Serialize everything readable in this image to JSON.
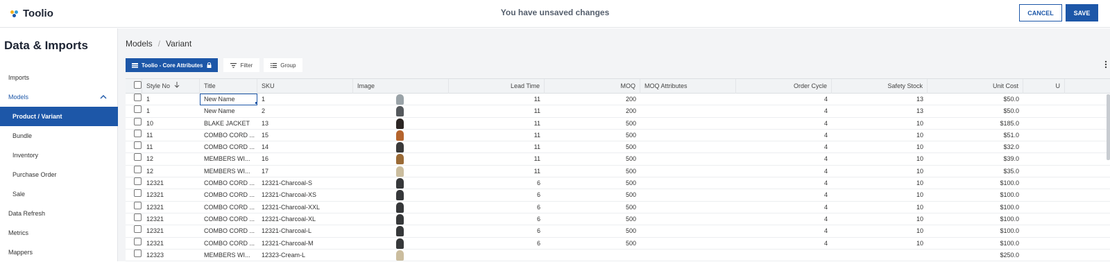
{
  "app": {
    "name": "Toolio",
    "logo_colors": [
      "#f2b01e",
      "#2f9bd7",
      "#1d57a8"
    ]
  },
  "header": {
    "status": "You have unsaved changes",
    "cancel_label": "CANCEL",
    "save_label": "SAVE"
  },
  "sidebar": {
    "title": "Data & Imports",
    "items": [
      {
        "label": "Imports"
      },
      {
        "label": "Models",
        "expanded": true
      },
      {
        "label": "Product / Variant",
        "selected": true
      },
      {
        "label": "Bundle"
      },
      {
        "label": "Inventory"
      },
      {
        "label": "Purchase Order"
      },
      {
        "label": "Sale"
      },
      {
        "label": "Data Refresh"
      },
      {
        "label": "Metrics"
      },
      {
        "label": "Mappers"
      }
    ]
  },
  "breadcrumb": {
    "parent": "Models",
    "separator": "/",
    "current": "Variant"
  },
  "toolbar": {
    "view_label": "Toolio - Core Attributes",
    "filter_label": "Filter",
    "group_label": "Group"
  },
  "table": {
    "columns": [
      "Style No",
      "Title",
      "SKU",
      "Image",
      "Lead Time",
      "MOQ",
      "MOQ Attributes",
      "Order Cycle",
      "Safety Stock",
      "Unit Cost",
      "U"
    ],
    "rows": [
      {
        "style": "1",
        "title": "New Name",
        "sku": "1",
        "img": "#9aa3a8",
        "lead": "11",
        "moq": "200",
        "cycle": "4",
        "safety": "13",
        "cost": "$50.0"
      },
      {
        "style": "1",
        "title": "New Name",
        "sku": "2",
        "img": "#55595d",
        "lead": "11",
        "moq": "200",
        "cycle": "4",
        "safety": "13",
        "cost": "$50.0"
      },
      {
        "style": "10",
        "title": "BLAKE JACKET",
        "sku": "13",
        "img": "#2b2523",
        "lead": "11",
        "moq": "500",
        "cycle": "4",
        "safety": "10",
        "cost": "$185.0"
      },
      {
        "style": "11",
        "title": "COMBO CORD ...",
        "sku": "15",
        "img": "#b5642d",
        "lead": "11",
        "moq": "500",
        "cycle": "4",
        "safety": "10",
        "cost": "$51.0"
      },
      {
        "style": "11",
        "title": "COMBO CORD ...",
        "sku": "14",
        "img": "#3a3a3a",
        "lead": "11",
        "moq": "500",
        "cycle": "4",
        "safety": "10",
        "cost": "$32.0"
      },
      {
        "style": "12",
        "title": "MEMBERS WI...",
        "sku": "16",
        "img": "#9a6a36",
        "lead": "11",
        "moq": "500",
        "cycle": "4",
        "safety": "10",
        "cost": "$39.0"
      },
      {
        "style": "12",
        "title": "MEMBERS WI...",
        "sku": "17",
        "img": "#cbbd9e",
        "lead": "11",
        "moq": "500",
        "cycle": "4",
        "safety": "10",
        "cost": "$35.0"
      },
      {
        "style": "12321",
        "title": "COMBO CORD ...",
        "sku": "12321-Charcoal-S",
        "img": "#36383a",
        "lead": "6",
        "moq": "500",
        "cycle": "4",
        "safety": "10",
        "cost": "$100.0"
      },
      {
        "style": "12321",
        "title": "COMBO CORD ...",
        "sku": "12321-Charcoal-XS",
        "img": "#36383a",
        "lead": "6",
        "moq": "500",
        "cycle": "4",
        "safety": "10",
        "cost": "$100.0"
      },
      {
        "style": "12321",
        "title": "COMBO CORD ...",
        "sku": "12321-Charcoal-XXL",
        "img": "#36383a",
        "lead": "6",
        "moq": "500",
        "cycle": "4",
        "safety": "10",
        "cost": "$100.0"
      },
      {
        "style": "12321",
        "title": "COMBO CORD ...",
        "sku": "12321-Charcoal-XL",
        "img": "#36383a",
        "lead": "6",
        "moq": "500",
        "cycle": "4",
        "safety": "10",
        "cost": "$100.0"
      },
      {
        "style": "12321",
        "title": "COMBO CORD ...",
        "sku": "12321-Charcoal-L",
        "img": "#36383a",
        "lead": "6",
        "moq": "500",
        "cycle": "4",
        "safety": "10",
        "cost": "$100.0"
      },
      {
        "style": "12321",
        "title": "COMBO CORD ...",
        "sku": "12321-Charcoal-M",
        "img": "#36383a",
        "lead": "6",
        "moq": "500",
        "cycle": "4",
        "safety": "10",
        "cost": "$100.0"
      },
      {
        "style": "12323",
        "title": "MEMBERS WI...",
        "sku": "12323-Cream-L",
        "img": "#cbbd9e",
        "lead": "",
        "moq": "",
        "cycle": "",
        "safety": "",
        "cost": "$250.0"
      }
    ]
  }
}
